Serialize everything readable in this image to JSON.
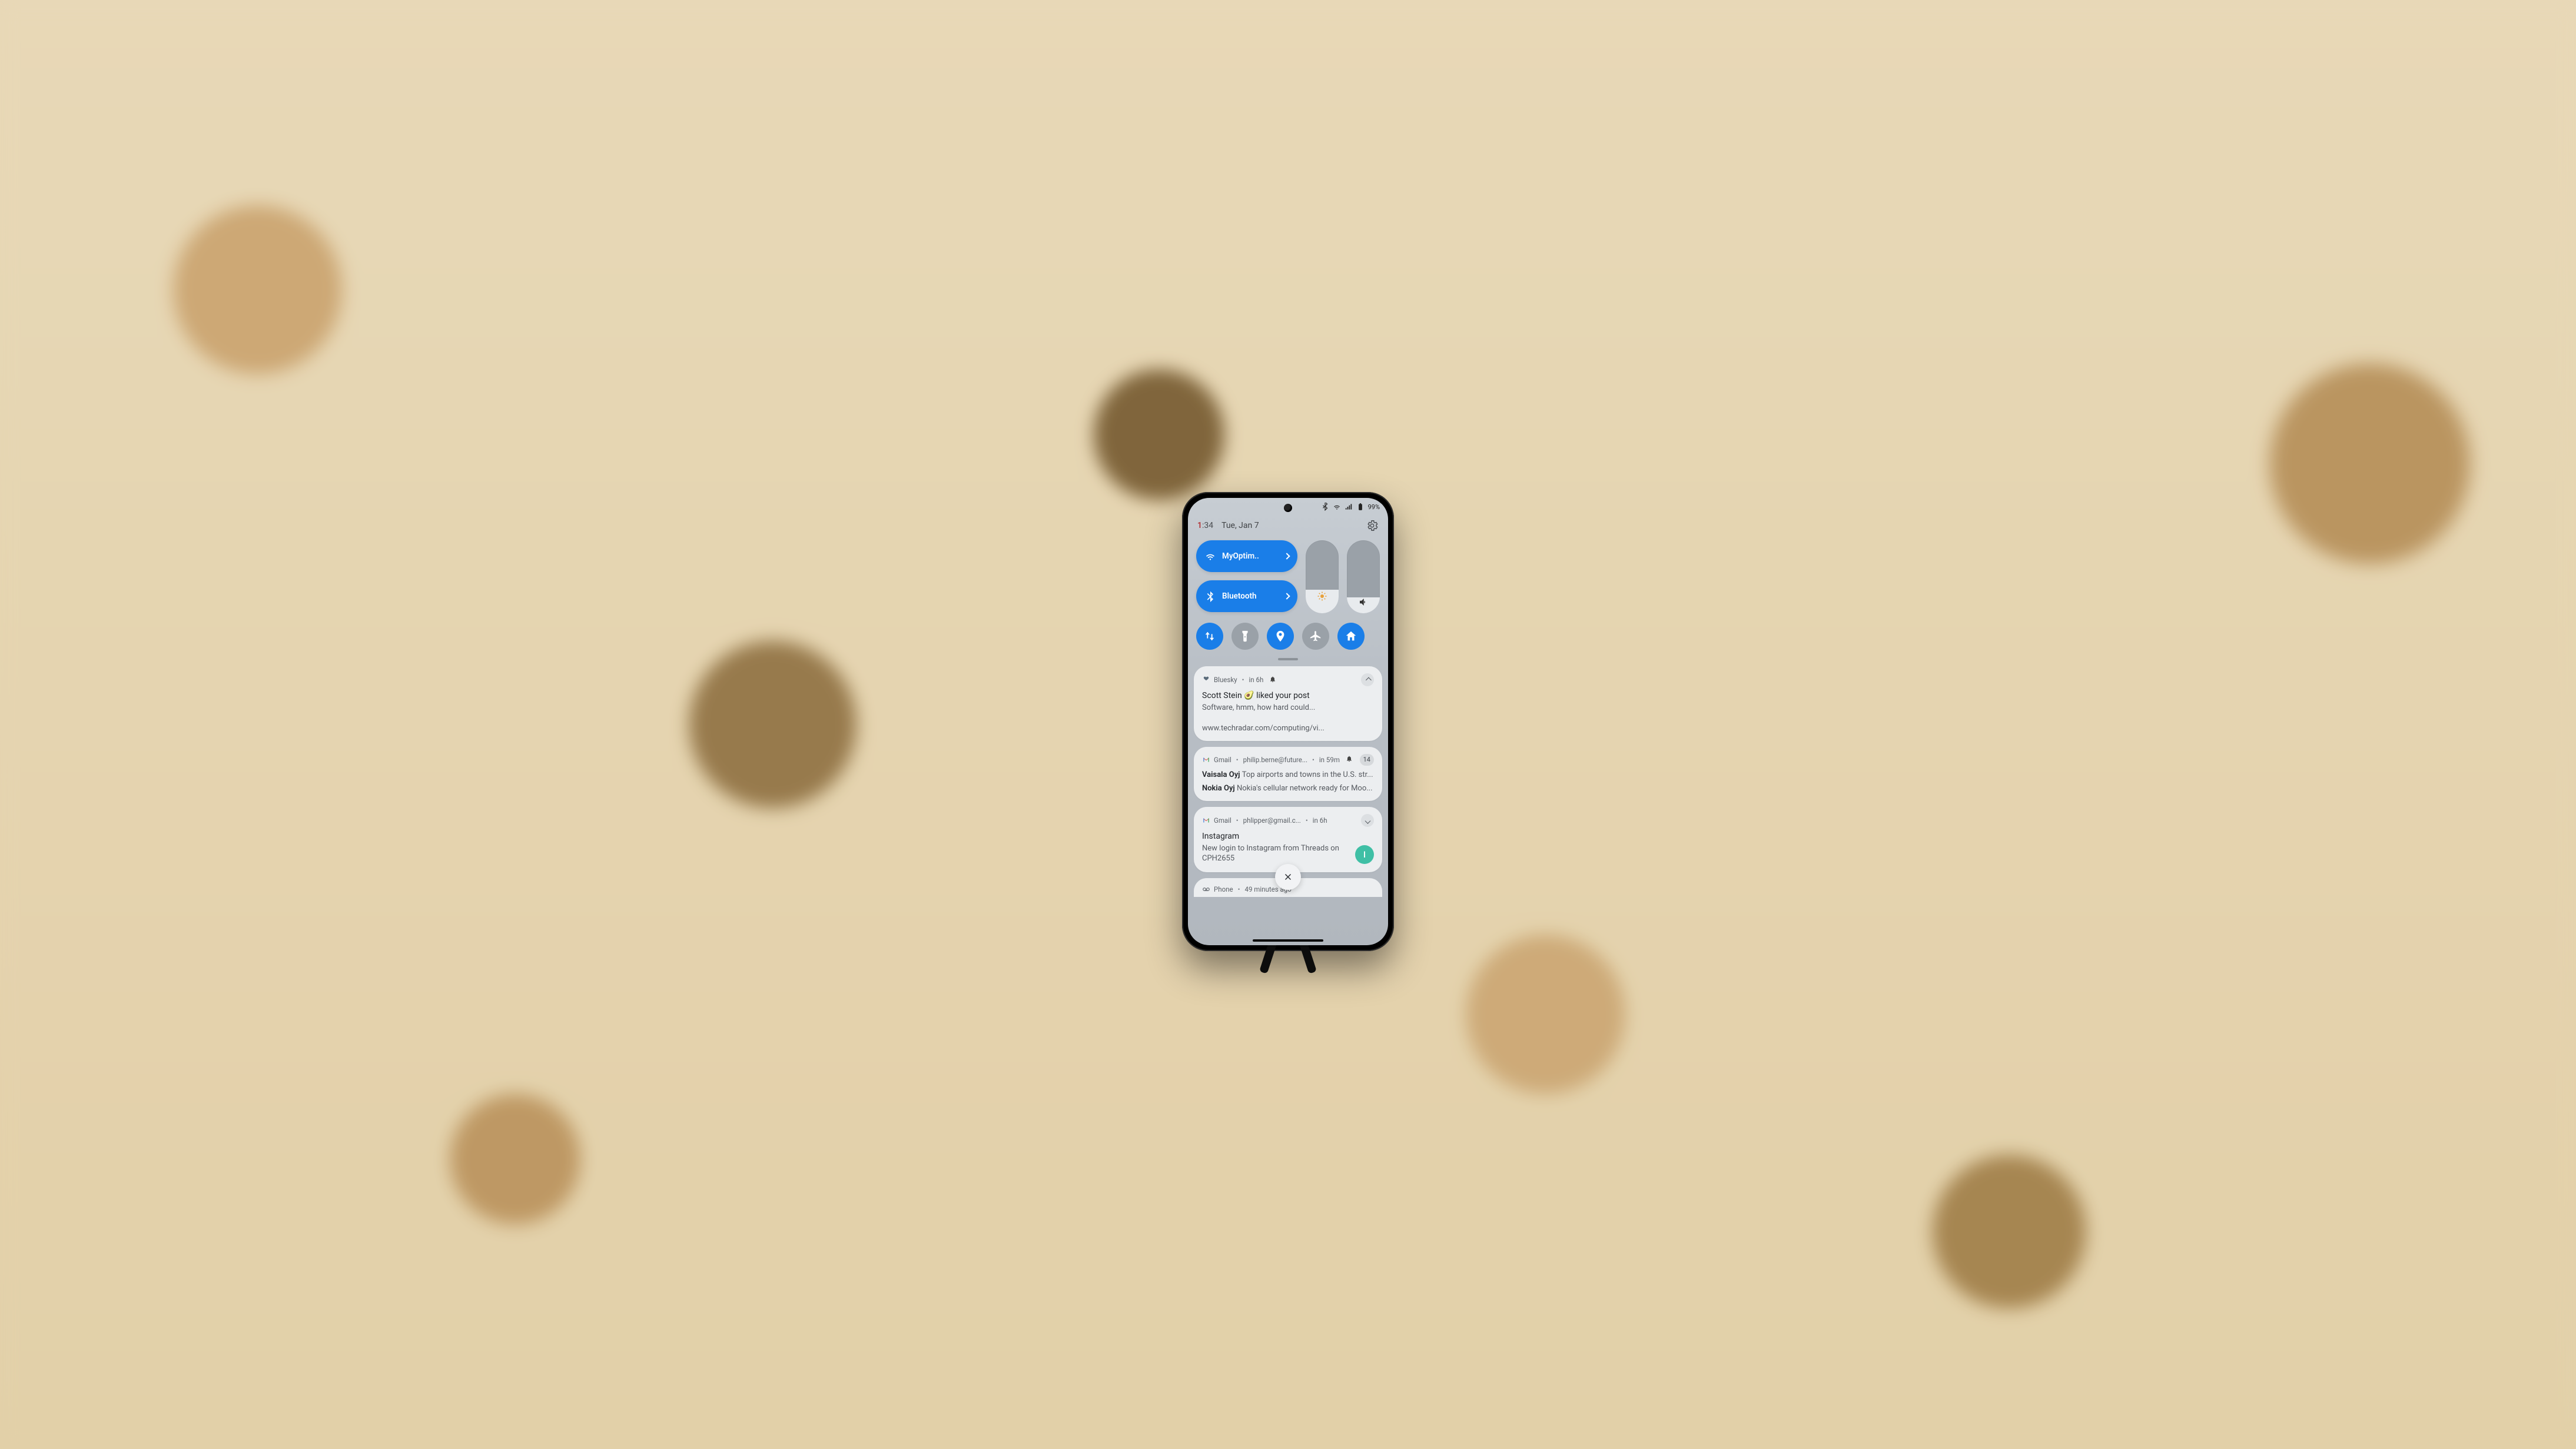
{
  "status": {
    "time_hour": "1",
    "time_min": ":34",
    "date": "Tue, Jan 7",
    "battery": "99%"
  },
  "qs": {
    "wifi_label": "MyOptim..",
    "bt_label": "Bluetooth",
    "brightness_pct": 32,
    "volume_pct": 22,
    "tiles": {
      "data_on": true,
      "flash_on": false,
      "location_on": true,
      "airplane_on": false,
      "home_on": true
    }
  },
  "notifications": [
    {
      "app": "Bluesky",
      "meta": "in 6h",
      "title": "Scott Stein 🥑 liked your post",
      "body": "Software, hmm, how hard could...",
      "link": "www.techradar.com/computing/vi...",
      "chevron": "up"
    },
    {
      "app": "Gmail",
      "account": "philip.berne@future...",
      "meta": "in 59m",
      "count": "14",
      "rows": [
        {
          "from": "Vaisala Oyj",
          "text": "Top airports and towns in the U.S. str..."
        },
        {
          "from": "Nokia Oyj",
          "text": "Nokia's cellular network ready for Moo..."
        }
      ]
    },
    {
      "app": "Gmail",
      "account": "phlipper@gmail.c...",
      "meta": "in 6h",
      "title": "Instagram",
      "body": "New login to Instagram from Threads on CPH2655",
      "avatar": "I",
      "chevron": "down"
    },
    {
      "app": "Phone",
      "meta": "49 minutes ago"
    }
  ]
}
